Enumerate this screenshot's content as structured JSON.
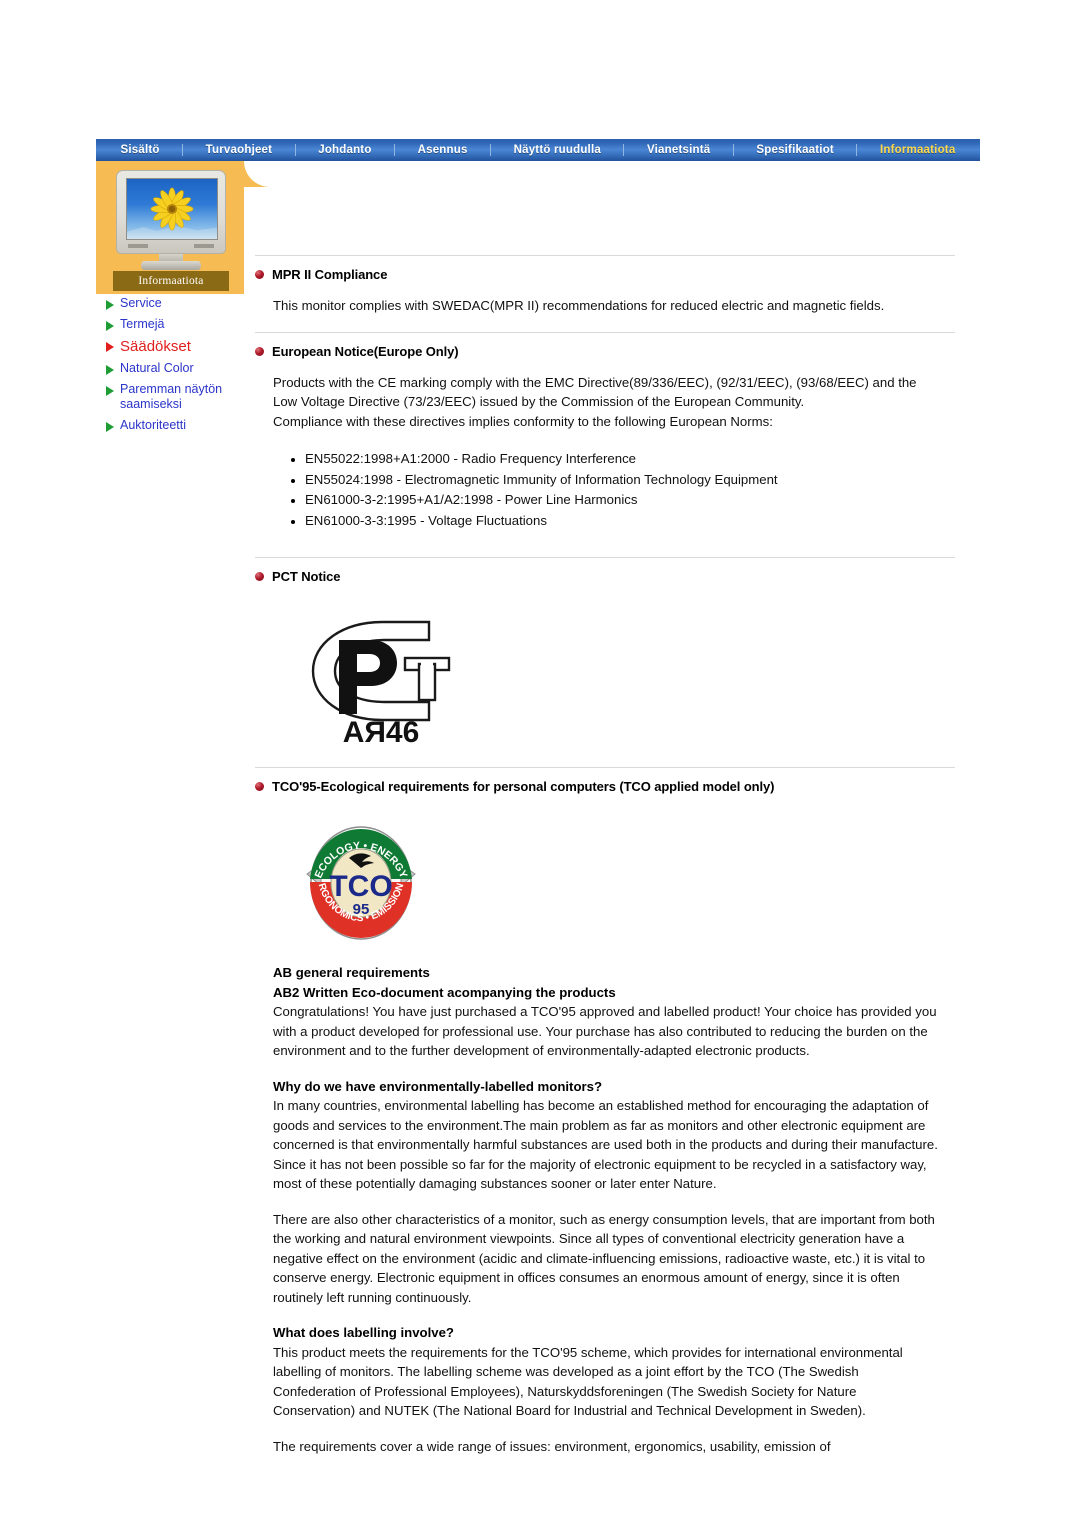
{
  "nav": {
    "items": [
      {
        "label": "Sisältö",
        "active": false
      },
      {
        "label": "Turvaohjeet",
        "active": false
      },
      {
        "label": "Johdanto",
        "active": false
      },
      {
        "label": "Asennus",
        "active": false
      },
      {
        "label": "Näyttö ruudulla",
        "active": false
      },
      {
        "label": "Vianetsintä",
        "active": false
      },
      {
        "label": "Spesifikaatiot",
        "active": false
      },
      {
        "label": "Informaatiota",
        "active": true
      }
    ],
    "active_color": "#ffd94a",
    "bar_color": "#2f67b6"
  },
  "sidebar": {
    "panel_color": "#f6bb52",
    "caption": "Informaatiota",
    "caption_bg": "#8a6a15",
    "thumbnail_name": "monitor-sunflower-thumbnail",
    "links": [
      {
        "label": "Service",
        "active": false
      },
      {
        "label": "Termejä",
        "active": false
      },
      {
        "label": "Säädökset",
        "active": true
      },
      {
        "label": "Natural Color",
        "active": false
      },
      {
        "label": "Paremman näytön saamiseksi",
        "active": false
      },
      {
        "label": "Auktoriteetti",
        "active": false
      }
    ],
    "link_color": "#2b35c9",
    "active_link_color": "#e21d1d",
    "arrow_color": "#1f9d35"
  },
  "content": {
    "sections": [
      {
        "id": "mpr",
        "title": "MPR II Compliance",
        "body": "This monitor complies with SWEDAC(MPR II) recommendations for reduced electric and magnetic fields."
      },
      {
        "id": "european",
        "title": "European Notice(Europe Only)",
        "body1": "Products with the CE marking comply with the EMC Directive(89/336/EEC), (92/31/EEC), (93/68/EEC) and the Low Voltage Directive (73/23/EEC) issued by the Commission of the European Community.",
        "body2": "Compliance with these directives implies conformity to the following European Norms:",
        "norms": [
          "EN55022:1998+A1:2000 - Radio Frequency Interference",
          "EN55024:1998 - Electromagnetic Immunity of Information Technology Equipment",
          "EN61000-3-2:1995+A1/A2:1998 - Power Line Harmonics",
          "EN61000-3-3:1995 - Voltage Fluctuations"
        ]
      },
      {
        "id": "pct",
        "title": "PCT Notice",
        "logo_name": "pct-certification-mark",
        "logo_code": "AЯ46"
      },
      {
        "id": "tco",
        "title": "TCO'95-Ecological requirements for personal computers (TCO applied model only)",
        "logo_name": "tco95-certification-logo",
        "logo_text": {
          "top_arc": "ECOLOGY • ENERGY",
          "bottom_arc": "ERGONOMICS • EMISSIONS",
          "center": "TCO",
          "year": "95"
        },
        "heading1": "AB general requirements",
        "heading2": "AB2 Written Eco-document acompanying the products",
        "para1": "Congratulations! You have just purchased a TCO'95 approved and labelled product! Your choice has provided you with a product developed for professional use. Your purchase has also contributed to reducing the burden on the environment and to the further development of environmentally-adapted electronic products.",
        "heading3": "Why do we have environmentally-labelled monitors?",
        "para2": "In many countries, environmental labelling has become an established method for encouraging the adaptation of goods and services to the environment.The main problem as far as monitors and other electronic equipment are concerned is that environmentally harmful substances are used both in the products and during their manufacture. Since it has not been possible so far for the majority of electronic equipment to be recycled in a satisfactory way, most of these potentially damaging substances sooner or later enter Nature.",
        "para3": "There are also other characteristics of a monitor, such as energy consumption levels, that are important from both the working and natural environment viewpoints. Since all types of conventional electricity generation have a negative effect on the environment (acidic and climate-influencing emissions, radioactive waste, etc.) it is vital to conserve energy. Electronic equipment in offices consumes an enormous amount of energy, since it is often routinely left running continuously.",
        "heading4": "What does labelling involve?",
        "para4": "This product meets the requirements for the TCO'95 scheme, which provides for international environmental labelling of monitors. The labelling scheme was developed as a joint effort by the TCO (The Swedish Confederation of Professional Employees), Naturskyddsforeningen (The Swedish Society for Nature Conservation) and NUTEK (The National Board for Industrial and Technical Development in Sweden).",
        "para5": "The requirements cover a wide range of issues: environment, ergonomics, usability, emission of"
      }
    ]
  }
}
